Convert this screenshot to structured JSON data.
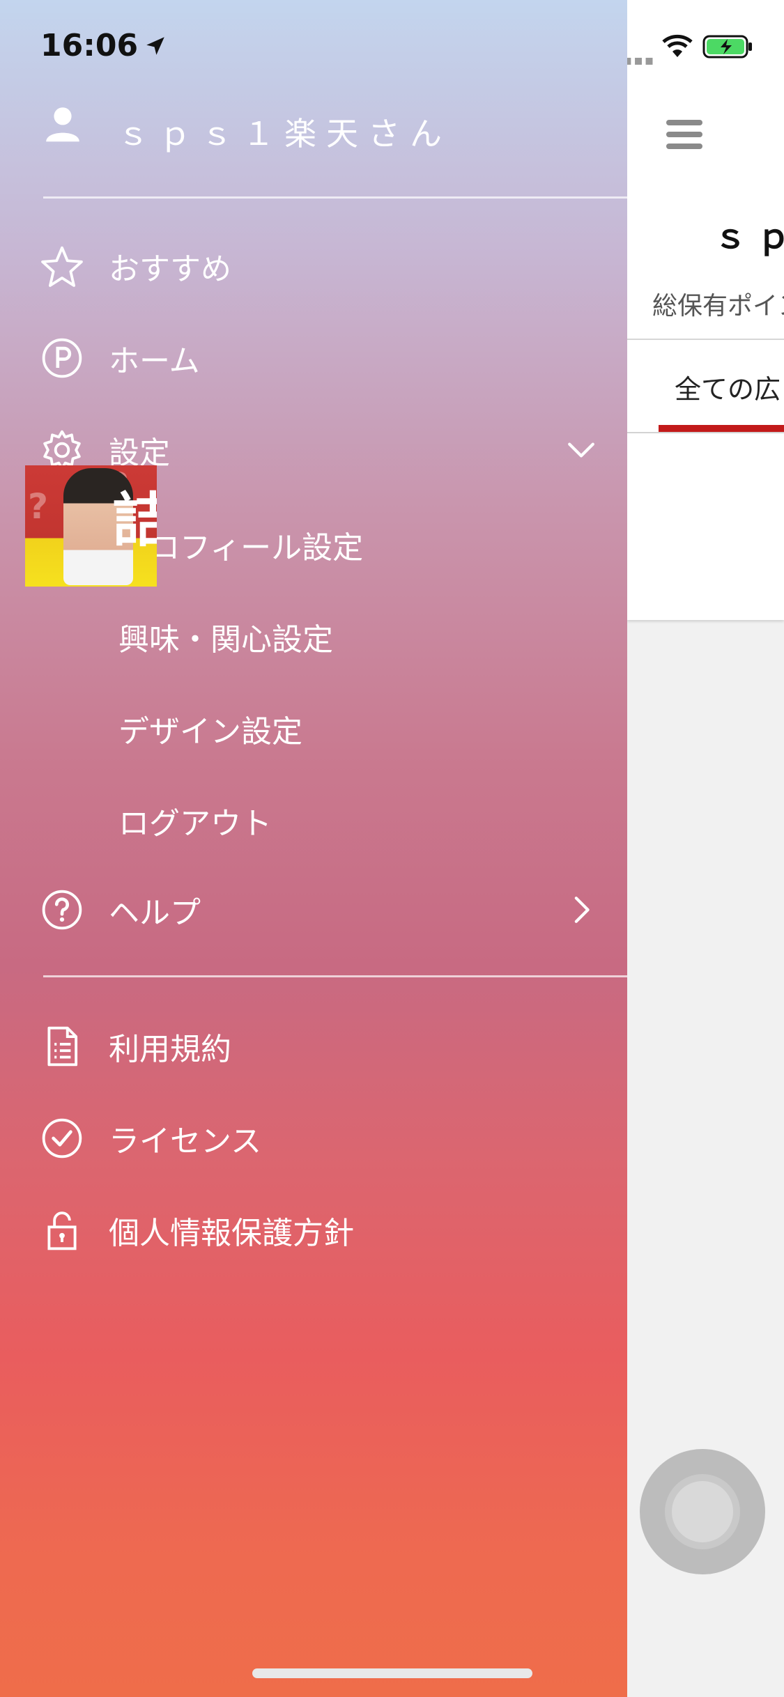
{
  "status_bar": {
    "time": "16:06"
  },
  "drawer": {
    "user_name": "ｓｐｓ１楽天さん",
    "menu": [
      {
        "label": "おすすめ",
        "icon": "star-icon"
      },
      {
        "label": "ホーム",
        "icon": "points-icon"
      },
      {
        "label": "設定",
        "icon": "gear-icon",
        "expanded": true
      }
    ],
    "settings_submenu": [
      "プロフィール設定",
      "興味・関心設定",
      "デザイン設定",
      "ログアウト"
    ],
    "help": {
      "label": "ヘルプ",
      "icon": "help-icon"
    },
    "footer_links": [
      {
        "label": "利用規約",
        "icon": "document-icon"
      },
      {
        "label": "ライセンス",
        "icon": "check-circle-icon"
      },
      {
        "label": "個人情報保護方針",
        "icon": "lock-icon"
      }
    ]
  },
  "main": {
    "title": "ｓｐｓ",
    "points_label": "総保有ポイン",
    "active_tab": "全ての広",
    "ad_text": "詰"
  },
  "colors": {
    "gradient_top": "#c3d5ee",
    "gradient_bottom": "#ef6d4a",
    "tab_accent": "#c21a1a"
  }
}
